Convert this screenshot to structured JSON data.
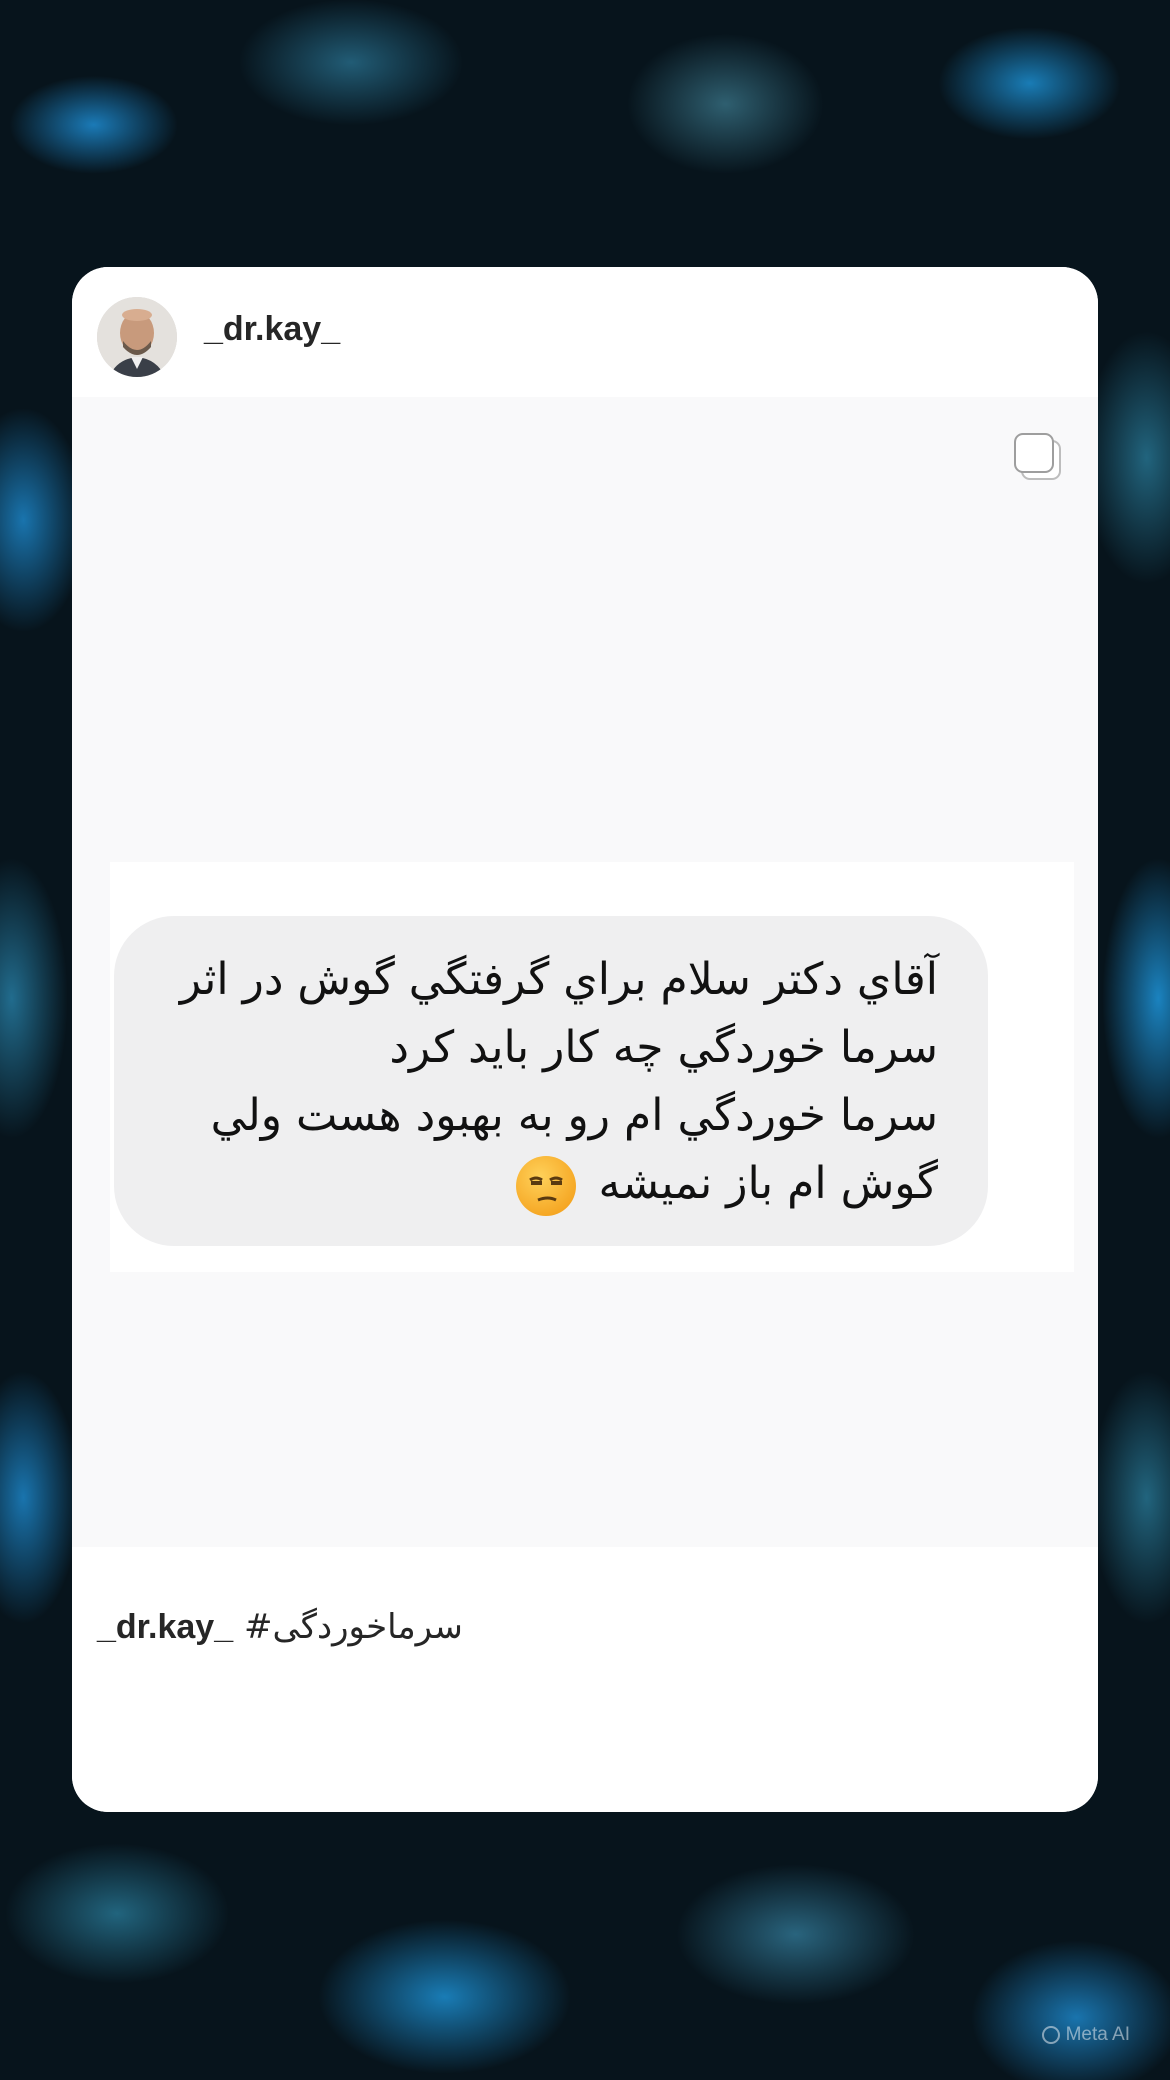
{
  "post": {
    "username": "_dr.kay_",
    "message_lines": [
      "آقاي دكتر سلام براي گرفتگي گوش در اثر",
      "سرما خوردگي چه كار بايد كرد",
      "سرما خوردگي ام رو به بهبود هست ولي",
      "گوش ام باز نميشه"
    ],
    "message_emoji": "unamused-face-emoji",
    "caption_username": "_dr.kay_",
    "caption_hashtag": "#سرماخوردگی"
  },
  "icons": {
    "avatar": "profile-photo",
    "carousel": "multiple-images-icon"
  },
  "watermark": {
    "text": "Meta AI"
  },
  "colors": {
    "card_bg": "#ffffff",
    "media_bg": "#f9f9fa",
    "bubble_bg": "#efeff0",
    "text": "#262626",
    "background_accent": "#1e8cd2"
  }
}
